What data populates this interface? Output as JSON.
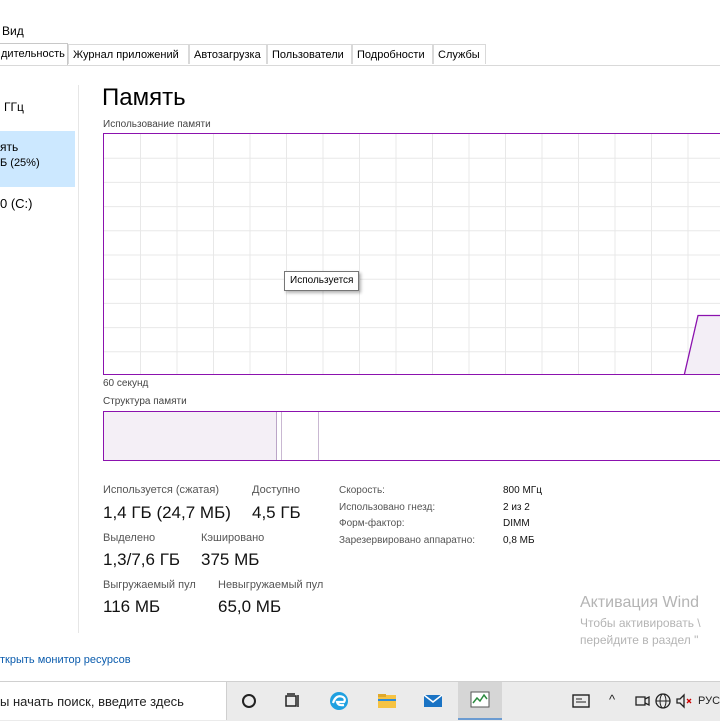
{
  "menu": {
    "view": "Вид"
  },
  "tabs": [
    {
      "label": "дительность",
      "active": true
    },
    {
      "label": "Журнал приложений"
    },
    {
      "label": "Автозагрузка"
    },
    {
      "label": "Пользователи"
    },
    {
      "label": "Подробности"
    },
    {
      "label": "Службы"
    }
  ],
  "sidebar": {
    "items": [
      {
        "line1": "ГГц"
      },
      {
        "line1": "ять",
        "line2": "Б (25%)",
        "selected": true
      },
      {
        "line1": "0 (C:)"
      }
    ],
    "monitor_link": "ткрыть монитор ресурсов"
  },
  "main": {
    "title": "Память",
    "usage_graph_label": "Использование памяти",
    "time_label": "60 секунд",
    "tooltip": "Используется",
    "structure_label": "Структура памяти",
    "usage_level": 0.25
  },
  "stats": {
    "in_use_label": "Используется (сжатая)",
    "in_use_value": "1,4 ГБ (24,7 МБ)",
    "available_label": "Доступно",
    "available_value": "4,5 ГБ",
    "committed_label": "Выделено",
    "committed_value": "1,3/7,6 ГБ",
    "cached_label": "Кэшировано",
    "cached_value": "375 МБ",
    "paged_label": "Выгружаемый пул",
    "paged_value": "116 МБ",
    "nonpaged_label": "Невыгружаемый пул",
    "nonpaged_value": "65,0 МБ"
  },
  "details": [
    {
      "key": "Скорость:",
      "value": "800 МГц"
    },
    {
      "key": "Использовано гнезд:",
      "value": "2 из 2"
    },
    {
      "key": "Форм-фактор:",
      "value": "DIMM"
    },
    {
      "key": "Зарезервировано аппаратно:",
      "value": "0,8 МБ"
    }
  ],
  "activation": {
    "title": "Активация Wind",
    "line1": "Чтобы активировать \\",
    "line2": "перейдите в раздел \""
  },
  "taskbar": {
    "search_placeholder": "ы начать поиск, введите здесь",
    "lang": "РУС"
  },
  "colors": {
    "accent": "#8b12ae",
    "selected_bg": "#cce8ff",
    "link": "#0b5cad"
  }
}
